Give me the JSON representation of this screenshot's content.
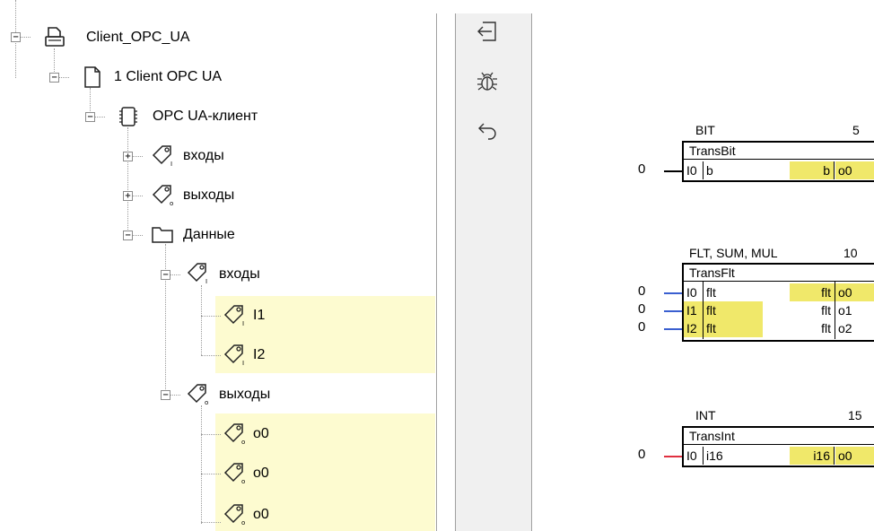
{
  "tree": {
    "root": {
      "label": "Client_OPC_UA",
      "icon": "printer-icon"
    },
    "client": {
      "label": "1 Client OPC UA",
      "icon": "document-icon"
    },
    "opc": {
      "label": "OPC UA-клиент",
      "icon": "chip-icon"
    },
    "inputs": {
      "label": "входы",
      "icon": "tag-icon",
      "subscript": "I"
    },
    "outputs": {
      "label": "выходы",
      "icon": "tag-icon",
      "subscript": "O"
    },
    "data": {
      "label": "Данные",
      "icon": "folder-icon"
    },
    "data_inputs": {
      "label": "входы",
      "subscript": "I"
    },
    "i1": {
      "label": "I1",
      "subscript": "I"
    },
    "i2": {
      "label": "I2",
      "subscript": "I"
    },
    "data_outputs": {
      "label": "выходы",
      "subscript": "O"
    },
    "o0a": {
      "label": "o0",
      "subscript": "O"
    },
    "o0b": {
      "label": "o0",
      "subscript": "O"
    },
    "o0c": {
      "label": "o0",
      "subscript": "O"
    },
    "highlight_color": "#fdfbd0"
  },
  "toolbar": {
    "buttons": [
      "login-arrow-icon",
      "bug-icon",
      "undo-arrow-icon"
    ]
  },
  "blocks": {
    "bit": {
      "header": "BIT",
      "number": "5",
      "name": "TransBit",
      "rows": [
        {
          "input": "0",
          "pin": "I0",
          "type": "b",
          "outtype": "b",
          "out": "o0"
        }
      ]
    },
    "flt": {
      "header": "FLT, SUM, MUL",
      "number": "10",
      "name": "TransFlt",
      "rows": [
        {
          "input": "0",
          "pin": "I0",
          "type": "flt",
          "outtype": "flt",
          "out": "o0"
        },
        {
          "input": "0",
          "pin": "I1",
          "type": "flt",
          "outtype": "flt",
          "out": "o1"
        },
        {
          "input": "0",
          "pin": "I2",
          "type": "flt",
          "outtype": "flt",
          "out": "o2"
        }
      ]
    },
    "int": {
      "header": "INT",
      "number": "15",
      "name": "TransInt",
      "rows": [
        {
          "input": "0",
          "pin": "I0",
          "type": "i16",
          "outtype": "i16",
          "out": "o0"
        }
      ]
    }
  },
  "colors": {
    "block_highlight": "#f0e86a",
    "wire_float": "#3a5fd0",
    "wire_int": "#e03040",
    "wire_bit": "#000000"
  }
}
